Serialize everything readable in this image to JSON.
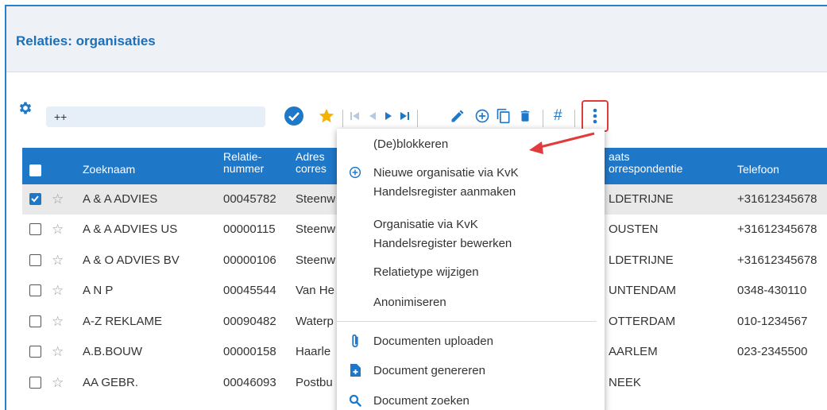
{
  "page": {
    "title": "Relaties: organisaties"
  },
  "toolbar": {
    "search_value": "++"
  },
  "table": {
    "headers": {
      "zoeknaam": "Zoeknaam",
      "relatienummer_1": "Relatie-",
      "relatienummer_2": "nummer",
      "adres_1": "Adres",
      "adres_2": "corres",
      "plaats_1": "aats",
      "plaats_2": "orrespondentie",
      "telefoon": "Telefoon"
    },
    "rows": [
      {
        "name": "A & A ADVIES",
        "nummer": "00045782",
        "adres": "Steenw",
        "plaats": "LDETRIJNE",
        "telefoon": "+31612345678",
        "checked": true
      },
      {
        "name": "A & A ADVIES US",
        "nummer": "00000115",
        "adres": "Steenw",
        "plaats": "OUSTEN",
        "telefoon": "+31612345678",
        "checked": false
      },
      {
        "name": "A & O ADVIES BV",
        "nummer": "00000106",
        "adres": "Steenw",
        "plaats": "LDETRIJNE",
        "telefoon": "+31612345678",
        "checked": false
      },
      {
        "name": "A N P",
        "nummer": "00045544",
        "adres": "Van He",
        "plaats": "UNTENDAM",
        "telefoon": "0348-430110",
        "checked": false
      },
      {
        "name": "A-Z REKLAME",
        "nummer": "00090482",
        "adres": "Waterp",
        "plaats": "OTTERDAM",
        "telefoon": "010-1234567",
        "checked": false
      },
      {
        "name": "A.B.BOUW",
        "nummer": "00000158",
        "adres": "Haarle",
        "plaats": "AARLEM",
        "telefoon": "023-2345500",
        "checked": false
      },
      {
        "name": "AA GEBR.",
        "nummer": "00046093",
        "adres": "Postbu",
        "plaats": "NEEK",
        "telefoon": "",
        "checked": false
      }
    ]
  },
  "menu": {
    "items": {
      "deblokkeren": "(De)blokkeren",
      "nieuwe_1": "Nieuwe organisatie via KvK",
      "nieuwe_2": "Handelsregister aanmaken",
      "bewerken_1": "Organisatie via KvK",
      "bewerken_2": "Handelsregister bewerken",
      "relatietype": "Relatietype wijzigen",
      "anonimiseren": "Anonimiseren",
      "uploaden": "Documenten uploaden",
      "genereren": "Document genereren",
      "zoeken": "Document zoeken"
    }
  },
  "colors": {
    "brand": "#1f77c8",
    "title": "#1d6fb8",
    "star": "#f5b301",
    "highlight": "#e23b3b"
  }
}
